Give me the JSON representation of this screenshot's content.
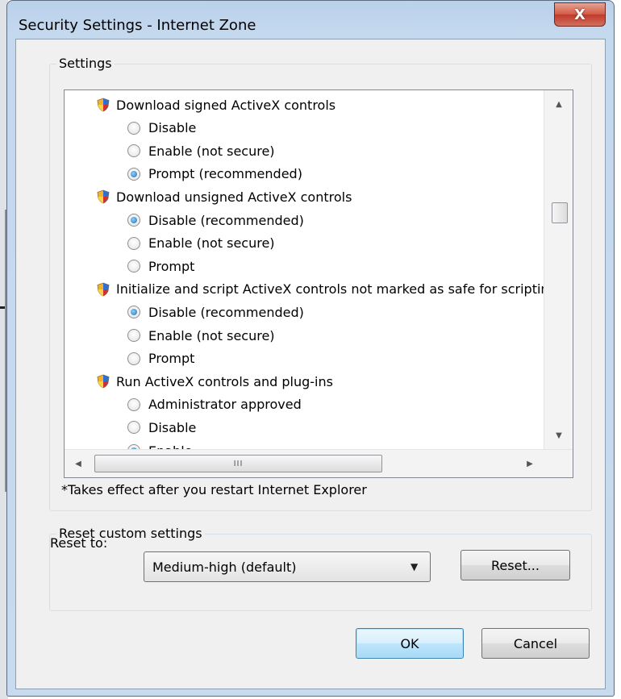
{
  "window": {
    "title": "Security Settings - Internet Zone",
    "close_label": "X"
  },
  "settings_group": {
    "label": "Settings",
    "items": [
      {
        "type": "heading",
        "label": "Download signed ActiveX controls"
      },
      {
        "type": "option",
        "label": "Disable",
        "checked": false
      },
      {
        "type": "option",
        "label": "Enable (not secure)",
        "checked": false
      },
      {
        "type": "option",
        "label": "Prompt (recommended)",
        "checked": true
      },
      {
        "type": "heading",
        "label": "Download unsigned ActiveX controls"
      },
      {
        "type": "option",
        "label": "Disable (recommended)",
        "checked": true
      },
      {
        "type": "option",
        "label": "Enable (not secure)",
        "checked": false
      },
      {
        "type": "option",
        "label": "Prompt",
        "checked": false
      },
      {
        "type": "heading",
        "label": "Initialize and script ActiveX controls not marked as safe for scripting"
      },
      {
        "type": "option",
        "label": "Disable (recommended)",
        "checked": true
      },
      {
        "type": "option",
        "label": "Enable (not secure)",
        "checked": false
      },
      {
        "type": "option",
        "label": "Prompt",
        "checked": false
      },
      {
        "type": "heading",
        "label": "Run ActiveX controls and plug-ins"
      },
      {
        "type": "option",
        "label": "Administrator approved",
        "checked": false
      },
      {
        "type": "option",
        "label": "Disable",
        "checked": false
      },
      {
        "type": "option",
        "label": "Enable",
        "checked": true
      }
    ],
    "scroll": {
      "vertical_position": 0.3,
      "horizontal_position": 0.0
    },
    "hscroll_thumb_grip": "III",
    "note": "*Takes effect after you restart Internet Explorer"
  },
  "reset_group": {
    "label": "Reset custom settings",
    "reset_to_label": "Reset to:",
    "selected_level": "Medium-high (default)",
    "reset_button": "Reset..."
  },
  "buttons": {
    "ok": "OK",
    "cancel": "Cancel"
  },
  "colors": {
    "title_bar": "#c4d8ee",
    "close_button": "#c0392b",
    "ok_border": "#3c7fb1"
  }
}
